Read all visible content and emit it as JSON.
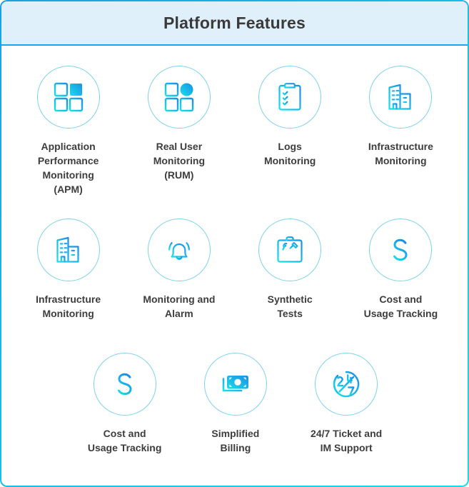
{
  "header": {
    "title": "Platform Features",
    "background_color": "#E0F0FA",
    "border_color": "#1CA5E8"
  },
  "theme": {
    "border_gradient_start": "#1CA0E8",
    "border_gradient_end": "#16DCE8",
    "icon_circle_border": "#7FD2EE",
    "icon_gradient_start": "#1B8EE8",
    "icon_gradient_end": "#18E0E8",
    "label_color": "#3D3D3D"
  },
  "features": {
    "rows": [
      [
        {
          "icon": "grid-squares-icon",
          "label": "Application\nPerformance\nMonitoring\n(APM)"
        },
        {
          "icon": "grid-square-circle-icon",
          "label": "Real User\nMonitoring\n(RUM)"
        },
        {
          "icon": "clipboard-checklist-icon",
          "label": "Logs\nMonitoring"
        },
        {
          "icon": "buildings-icon",
          "label": "Infrastructure\nMonitoring"
        }
      ],
      [
        {
          "icon": "buildings-icon",
          "label": "Infrastructure\nMonitoring"
        },
        {
          "icon": "alarm-bell-icon",
          "label": "Monitoring and\nAlarm"
        },
        {
          "icon": "toolbox-icon",
          "label": "Synthetic\nTests"
        },
        {
          "icon": "dollar-sign-icon",
          "label": "Cost and\nUsage Tracking"
        }
      ],
      [
        {
          "icon": "dollar-sign-icon",
          "label": "Cost and\nUsage Tracking"
        },
        {
          "icon": "banknote-icon",
          "label": "Simplified\nBilling"
        },
        {
          "icon": "twentyfour-seven-icon",
          "label": "24/7 Ticket and\nIM Support"
        }
      ]
    ]
  }
}
